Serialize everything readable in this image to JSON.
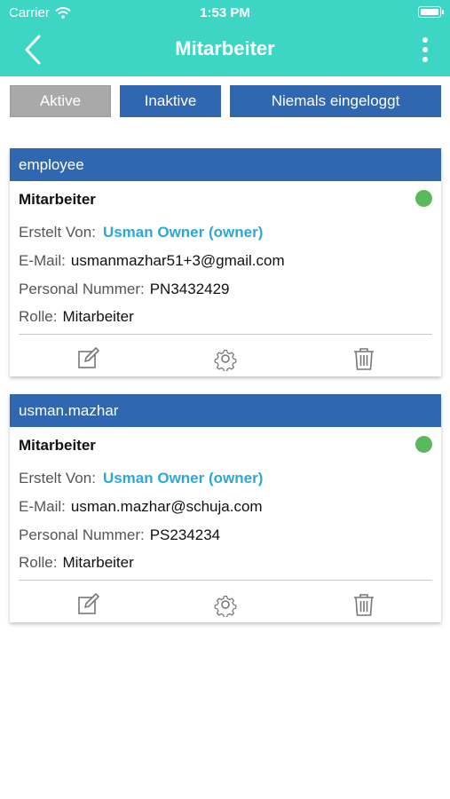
{
  "status_bar": {
    "carrier": "Carrier",
    "time": "1:53 PM"
  },
  "header": {
    "title": "Mitarbeiter"
  },
  "filters": {
    "active": "Aktive",
    "inactive": "Inaktive",
    "never": "Niemals eingeloggt"
  },
  "labels": {
    "created_by": "Erstelt Von:",
    "email": "E-Mail:",
    "personal_number": "Personal Nummer:",
    "role": "Rolle:"
  },
  "employees": [
    {
      "username": "employee",
      "title": "Mitarbeiter",
      "created_by": "Usman Owner (owner)",
      "email": "usmanmazhar51+3@gmail.com",
      "personal_number": "PN3432429",
      "role": "Mitarbeiter",
      "status_color": "#5cb85c"
    },
    {
      "username": "usman.mazhar",
      "title": "Mitarbeiter",
      "created_by": "Usman Owner (owner)",
      "email": "usman.mazhar@schuja.com",
      "personal_number": "PS234234",
      "role": "Mitarbeiter",
      "status_color": "#5cb85c"
    }
  ],
  "colors": {
    "header_teal": "#3dd6c4",
    "primary_blue": "#2f67b1",
    "active_gray": "#a9a9a9",
    "link_blue": "#2aa8d8",
    "status_green": "#5cb85c"
  },
  "icons": [
    "wifi-icon",
    "battery-icon",
    "back-chevron-icon",
    "more-vertical-icon",
    "edit-icon",
    "settings-gear-icon",
    "trash-icon"
  ]
}
